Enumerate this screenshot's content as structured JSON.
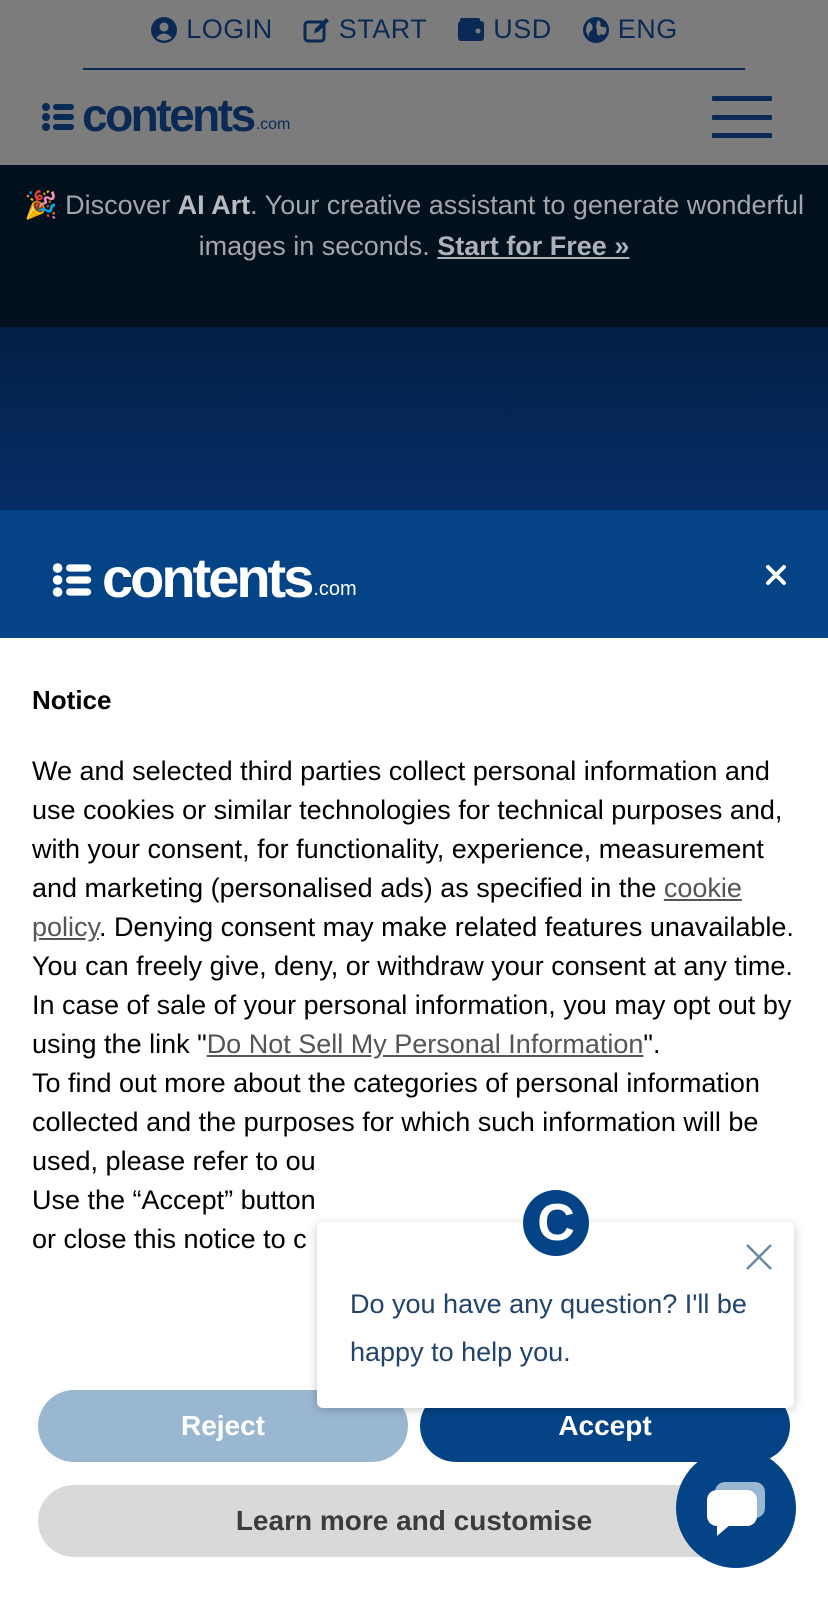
{
  "topnav": {
    "login": "LOGIN",
    "start": "START",
    "currency": "USD",
    "language": "ENG"
  },
  "brand": {
    "word": "contents",
    "tld": ".com"
  },
  "promo": {
    "emoji": "🎉",
    "prefix": "Discover ",
    "highlight": "AI Art",
    "text": ". Your creative assistant to generate wonderful images in seconds. ",
    "cta": "Start for Free »"
  },
  "consent": {
    "title": "Notice",
    "p1_before": "We and selected third parties collect personal information and use cookies or similar technologies for technical purposes and, with your consent, for functionality, experience, measurement and marketing (personalised ads) as specified in the ",
    "p1_link": "cookie policy",
    "p1_after": ". Denying consent may make related features unavailable.",
    "p2": "You can freely give, deny, or withdraw your consent at any time.",
    "p3_before": "In case of sale of your personal information, you may opt out by using the link \"",
    "p3_link": "Do Not Sell My Personal Information",
    "p3_after": "\".",
    "p4": "To find out more about the categories of personal information collected and the purposes for which such information will be used, please refer to ou",
    "p5": "Use the “Accept” button",
    "p6": "or close this notice to c",
    "reject_label": "Reject",
    "accept_label": "Accept",
    "learn_label": "Learn more and customise"
  },
  "chat": {
    "avatar_letter": "C",
    "message": "Do you have any question? I'll be happy to help you."
  },
  "colors": {
    "brand_navy": "#044386",
    "brand_dark": "#0a2a55",
    "reject_bg": "#9ab7d2",
    "learn_bg": "#d9d9d9"
  },
  "icons": [
    "user-circle-icon",
    "edit-icon",
    "wallet-icon",
    "globe-icon",
    "list-bullets-icon",
    "menu-icon",
    "close-icon",
    "chat-icon"
  ]
}
